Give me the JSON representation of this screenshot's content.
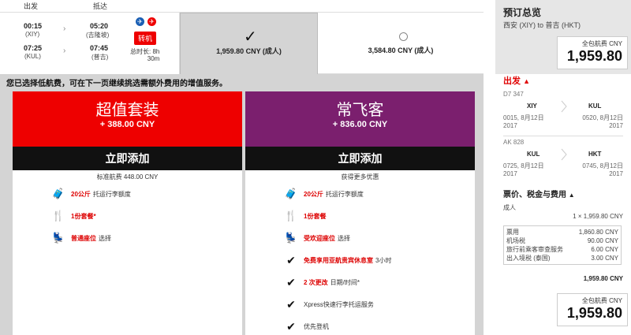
{
  "header": {
    "depart_label": "出发",
    "arrive_label": "抵达"
  },
  "flight": {
    "leg1_dep_time": "00:15",
    "leg1_dep_code": "(XIY)",
    "leg1_arr_time": "05:20",
    "leg1_arr_code": "(吉隆坡)",
    "leg2_dep_time": "07:25",
    "leg2_dep_code": "(KUL)",
    "leg2_arr_time": "07:45",
    "leg2_arr_code": "(普吉)",
    "transfer_label": "转机",
    "duration_label": "总时长: 8h",
    "duration_min": "30m"
  },
  "fares": {
    "selected_price": "1,959.80 CNY (成人)",
    "alt_price": "3,584.80 CNY (成人)"
  },
  "upsell": {
    "notice": "您已选择低航费，可在下一页继续挑选需额外费用的增值服务。",
    "value_pack": {
      "title": "超值套装",
      "price": "+ 388.00 CNY",
      "add_label": "立即添加",
      "subtitle": "标准航费 448.00 CNY",
      "color": "#ee0000",
      "features": [
        {
          "icon": "luggage-icon",
          "red": "20公斤",
          "text": "托运行李额度"
        },
        {
          "icon": "meal-icon",
          "red": "1份套餐*",
          "text": ""
        },
        {
          "icon": "seat-icon",
          "red": "普通座位",
          "text": "选择"
        }
      ]
    },
    "frequent_flyer": {
      "title": "常飞客",
      "price": "+ 836.00 CNY",
      "add_label": "立即添加",
      "subtitle": "获得更多优惠",
      "color": "#7b1f6e",
      "features": [
        {
          "icon": "luggage-icon",
          "red": "20公斤",
          "text": "托运行李额度"
        },
        {
          "icon": "meal-icon",
          "red": "1份套餐",
          "text": ""
        },
        {
          "icon": "seat-icon",
          "red": "受欢迎座位",
          "text": "选择"
        },
        {
          "icon": "check-icon",
          "red": "免费享用亚航贵宾休息室",
          "text": "3小时"
        },
        {
          "icon": "check-icon",
          "red": "2 次更改",
          "text": "日期/时间*"
        },
        {
          "icon": "check-icon",
          "red": "",
          "text": "Xpress快速行李托运服务"
        },
        {
          "icon": "check-icon",
          "red": "",
          "text": "优先登机"
        }
      ]
    }
  },
  "summary": {
    "title": "预订总览",
    "route": "西安 (XIY) to 普吉 (HKT)",
    "total_label": "全包航费 CNY",
    "total_value": "1,959.80",
    "depart_section": "出发",
    "seg1": {
      "flight_no": "D7 347",
      "from": "XIY",
      "to": "KUL",
      "dep": "0015, 8月12日",
      "dep_year": "2017",
      "arr": "0520, 8月12日",
      "arr_year": "2017"
    },
    "seg2": {
      "flight_no": "AK 828",
      "from": "KUL",
      "to": "HKT",
      "dep": "0725, 8月12日",
      "dep_year": "2017",
      "arr": "0745, 8月12日",
      "arr_year": "2017"
    },
    "fees_section": "票价、税金与费用",
    "pax_label": "成人",
    "pax_line": "1 × 1,959.80 CNY",
    "fee_rows": [
      {
        "label": "票用",
        "value": "1,860.80 CNY"
      },
      {
        "label": "机场税",
        "value": "90.00 CNY"
      },
      {
        "label": "旅行前乘客审查服务",
        "value": "6.00 CNY"
      },
      {
        "label": "出入境税 (泰国)",
        "value": "3.00 CNY"
      }
    ],
    "fees_total": "1,959.80 CNY",
    "accent": "#e00000"
  }
}
